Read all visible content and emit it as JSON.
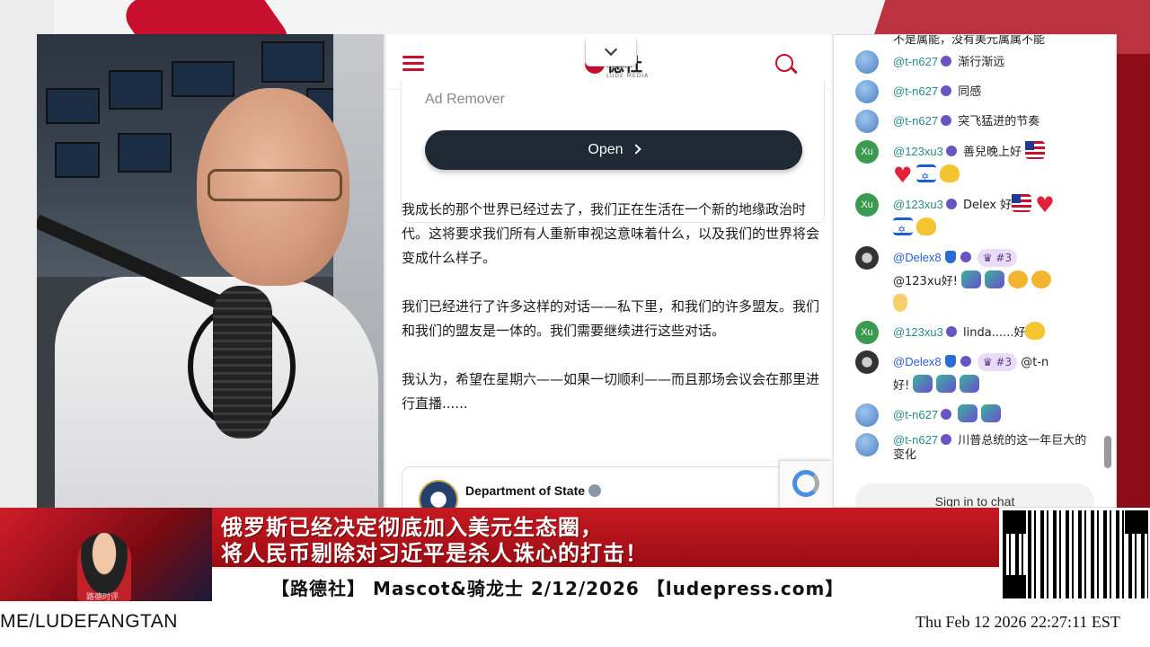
{
  "web": {
    "logo_text": "德社",
    "logo_sub": "LUDE MEDIA",
    "ad_label": "Ad Remover",
    "open_button": "Open",
    "article_paragraphs": [
      "我成长的那个世界已经过去了，我们正在生活在一个新的地缘政治时代。这将要求我们所有人重新审视这意味着什么，以及我们的世界将会变成什么样子。",
      "我们已经进行了许多这样的对话——私下里，和我们的许多盟友。我们和我们的盟友是一体的。我们需要继续进行这些对话。",
      "我认为，希望在星期六——如果一切顺利——而且那场会议会在那里进行直播......"
    ],
    "embed_name": "Department of State"
  },
  "chat": {
    "top_cut_text": "不是属能，没有美元属属不能",
    "messages": [
      {
        "avatar": "blue",
        "handle": "@t-n627",
        "text": "渐行渐远"
      },
      {
        "avatar": "blue",
        "handle": "@t-n627",
        "text": "同感"
      },
      {
        "avatar": "blue",
        "handle": "@t-n627",
        "text": "突飞猛进的节奏"
      },
      {
        "avatar": "green",
        "avatar_text": "Xu",
        "handle": "@123xu3",
        "text": "善兒晚上好"
      },
      {
        "avatar": "green",
        "avatar_text": "Xu",
        "handle": "@123xu3",
        "text": "Delex 好"
      },
      {
        "avatar": "dark",
        "handle": "@Delex8",
        "rank": "#3",
        "text": "@123xu好!"
      },
      {
        "avatar": "green",
        "avatar_text": "Xu",
        "handle": "@123xu3",
        "text": "linda......好"
      },
      {
        "avatar": "dark",
        "handle": "@Delex8",
        "rank": "#3",
        "text": "@t-n",
        "text2": "好!"
      },
      {
        "avatar": "blue",
        "handle": "@t-n627",
        "text": ""
      },
      {
        "avatar": "blue",
        "handle": "@t-n627",
        "text": "川普总统的这一年巨大的变化"
      }
    ],
    "sign_in": "Sign in to chat"
  },
  "banner": {
    "left_label": "路德时评",
    "headline_line1": "俄罗斯已经决定彻底加入美元生态圈，",
    "headline_line2": "将人民币剔除对习近平是杀人诛心的打击！",
    "sub_text": "【路德社】 Mascot&骑龙士 2/12/2026 【ludepress.com】"
  },
  "footer": {
    "left_text": "ME/LUDEFANGTAN",
    "timestamp": "Thu Feb 12 2026 22:27:11 EST"
  },
  "colors": {
    "brand_red": "#c8102e",
    "button_dark": "#1f2933",
    "handle_teal": "#2a8a8a"
  }
}
